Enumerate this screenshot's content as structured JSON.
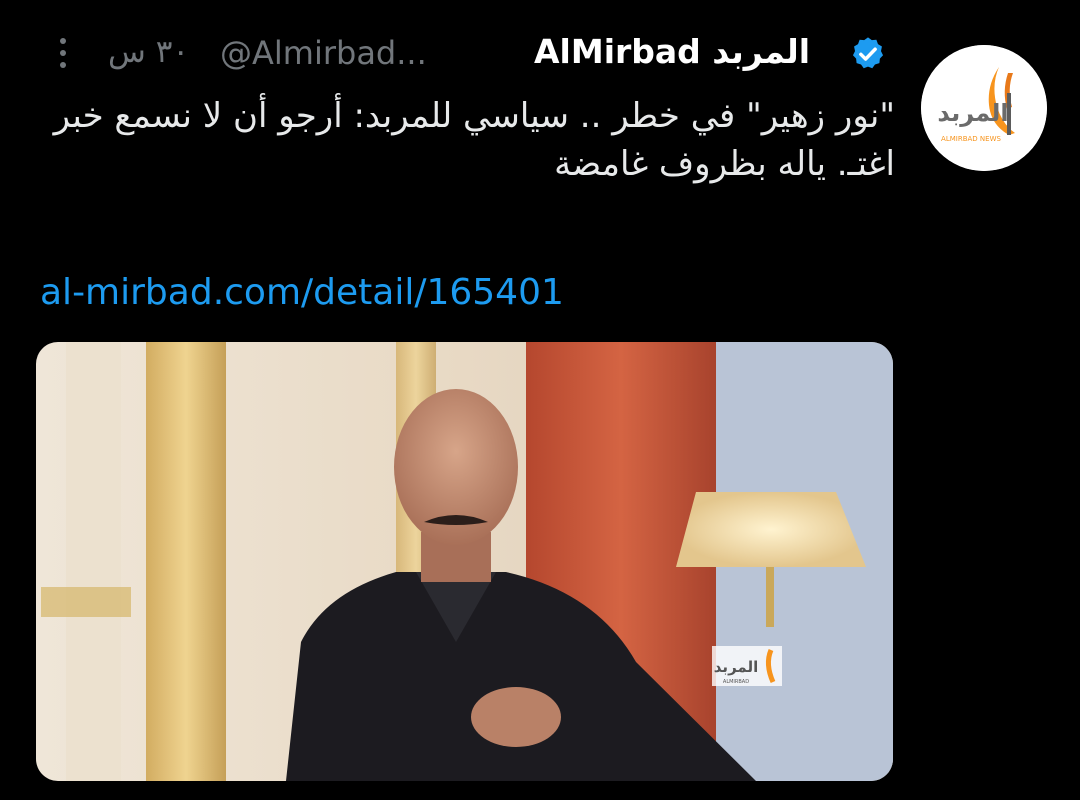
{
  "tweet": {
    "author_name": "AlMirbad المربد",
    "handle": "@Almirbad...",
    "time": "٣٠ س",
    "text": "\"نور زهير\" في خطر .. سياسي للمربد: أرجو أن لا نسمع خبر اغتـ. ياله بظروف غامضة",
    "link": "al-mirbad.com/detail/165401",
    "verified": true
  },
  "avatar": {
    "logo_text": "المربد",
    "logo_subtext": "ALMIRBAD NEWS",
    "accent": "#f7941d"
  },
  "media": {
    "watermark_text": "المربد",
    "watermark_subtext": "ALMIRBAD"
  },
  "icons": {
    "more": "more-dots-icon",
    "verified": "verified-badge-icon"
  },
  "colors": {
    "background": "#000000",
    "text": "#e7e9ea",
    "muted": "#71767b",
    "link": "#1d9bf0",
    "verified": "#1d9bf0"
  }
}
